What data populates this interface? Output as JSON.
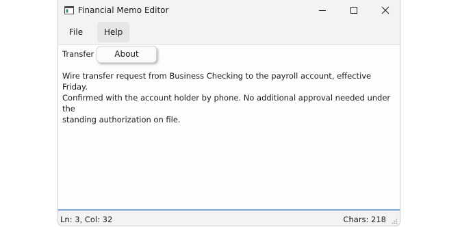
{
  "window": {
    "title": "Financial Memo Editor"
  },
  "titlebar": {
    "icon": "app-window-icon",
    "minimize": "minimize-icon",
    "maximize": "maximize-icon",
    "close": "close-icon"
  },
  "menu": {
    "file": "File",
    "help": "Help"
  },
  "help_menu": {
    "items": [
      "About"
    ]
  },
  "memo": {
    "subject_visible": "Transfer r",
    "body": "Wire transfer request from Business Checking to the payroll account, effective Friday.\nConfirmed with the account holder by phone. No additional approval needed under the\nstanding authorization on file."
  },
  "status": {
    "cursor": "Ln: 3, Col: 32",
    "chars": "Chars: 218"
  },
  "colors": {
    "accent_line": "#7ba7d8",
    "chrome": "#f3f3f3",
    "editor_bg": "#fdfdfd"
  }
}
